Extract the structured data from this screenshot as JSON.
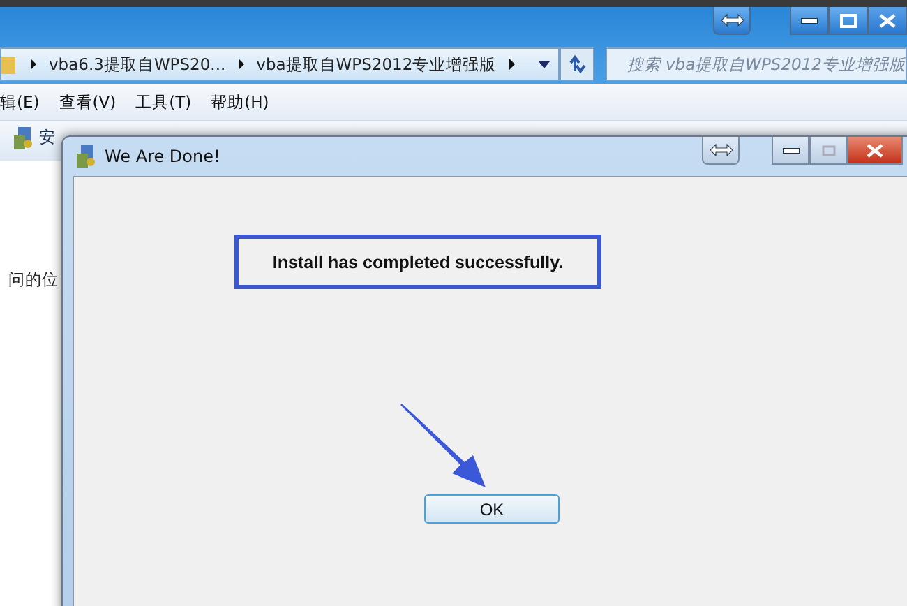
{
  "explorer": {
    "breadcrumbs": [
      "vba6.3提取自WPS20...",
      "vba提取自WPS2012专业增强版"
    ],
    "search": {
      "placeholder": "搜索 vba提取自WPS2012专业增强版"
    },
    "menu": [
      "辑(E)",
      "查看(V)",
      "工具(T)",
      "帮助(H)"
    ],
    "toolbar": [
      "安"
    ],
    "nav_text": "问的位"
  },
  "dialog": {
    "title": "We Are Done!",
    "message": "Install has completed successfully.",
    "buttons": [
      "OK"
    ]
  }
}
